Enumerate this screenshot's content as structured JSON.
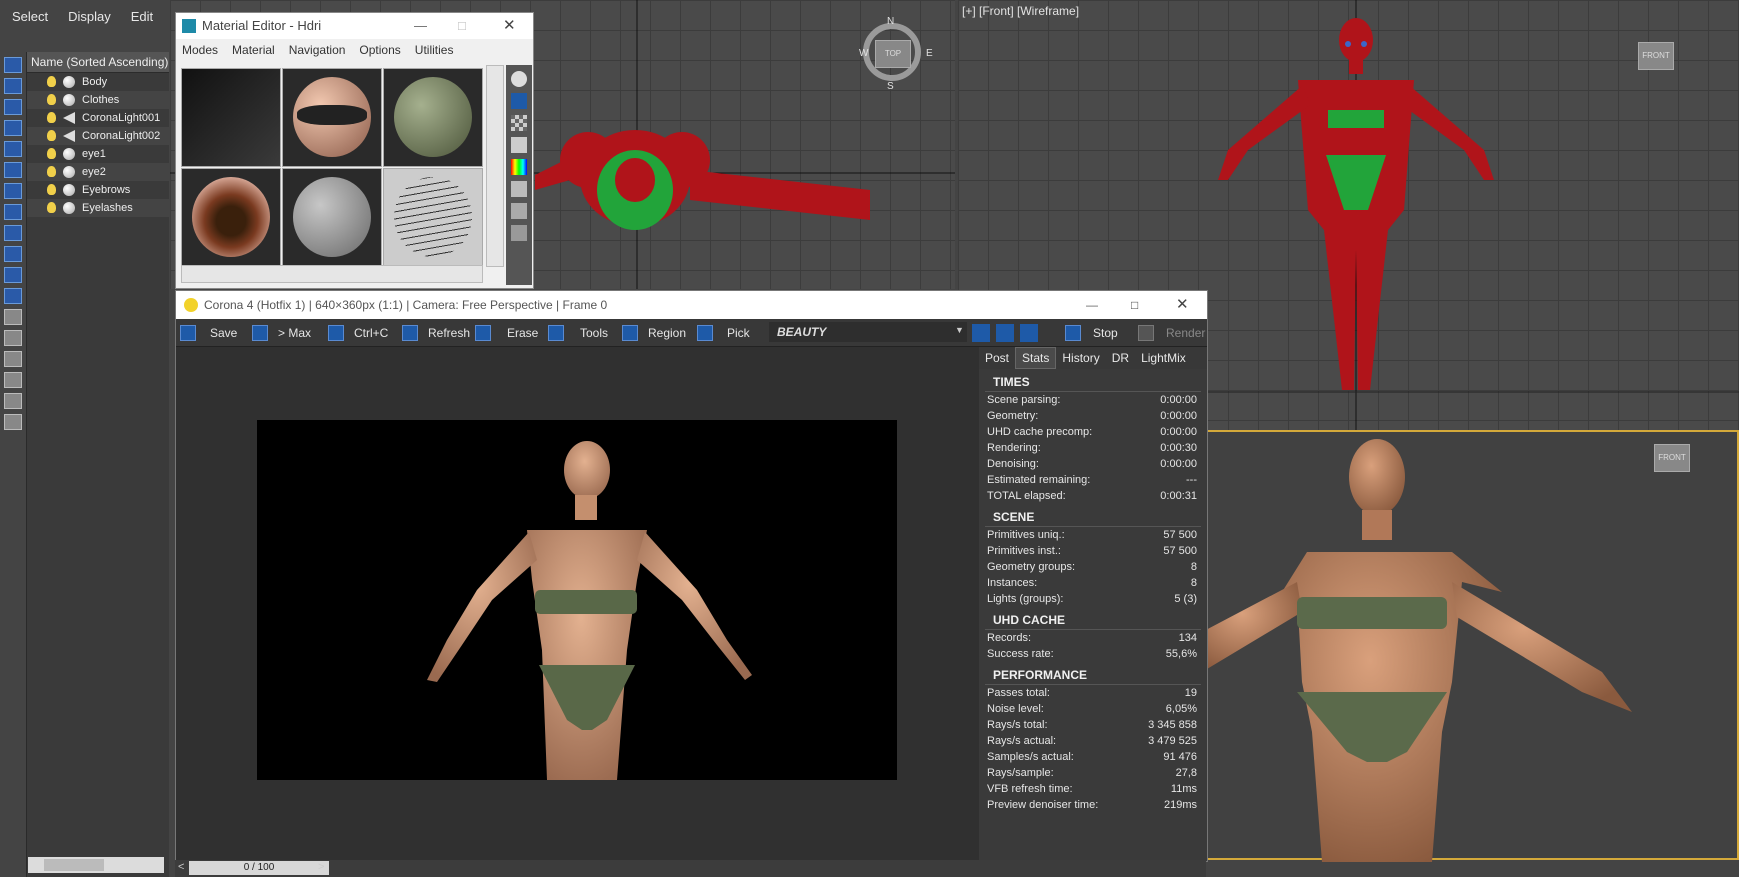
{
  "top_menu": [
    "Select",
    "Display",
    "Edit"
  ],
  "explorer": {
    "header": "Name (Sorted Ascending)",
    "items": [
      {
        "label": "Body",
        "icon": "sphere-icon"
      },
      {
        "label": "Clothes",
        "icon": "sphere-icon"
      },
      {
        "label": "CoronaLight001",
        "icon": "light-icon"
      },
      {
        "label": "CoronaLight002",
        "icon": "light-icon"
      },
      {
        "label": "eye1",
        "icon": "sphere-icon"
      },
      {
        "label": "eye2",
        "icon": "sphere-icon"
      },
      {
        "label": "Eyebrows",
        "icon": "sphere-icon"
      },
      {
        "label": "Eyelashes",
        "icon": "sphere-icon"
      }
    ]
  },
  "viewports": {
    "front_label": "[+] [Front] [Wireframe]",
    "compass": {
      "n": "N",
      "s": "S",
      "e": "E",
      "w": "W",
      "cube": "TOP"
    },
    "front_cube": "FRONT"
  },
  "material_editor": {
    "title": "Material Editor - Hdri",
    "menu": [
      "Modes",
      "Material",
      "Navigation",
      "Options",
      "Utilities"
    ]
  },
  "vfb": {
    "title": "Corona 4 (Hotfix 1) | 640×360px (1:1) | Camera: Free Perspective | Frame 0",
    "toolbar": {
      "save": "Save",
      "to_max": "> Max",
      "copy": "Ctrl+C",
      "refresh": "Refresh",
      "erase": "Erase",
      "tools": "Tools",
      "region": "Region",
      "pick": "Pick",
      "channel": "BEAUTY",
      "stop": "Stop",
      "render": "Render"
    },
    "tabs": [
      "Post",
      "Stats",
      "History",
      "DR",
      "LightMix"
    ],
    "active_tab": "Stats",
    "stats": {
      "times_title": "TIMES",
      "times": [
        {
          "label": "Scene parsing:",
          "value": "0:00:00"
        },
        {
          "label": "Geometry:",
          "value": "0:00:00"
        },
        {
          "label": "UHD cache precomp:",
          "value": "0:00:00"
        },
        {
          "label": "Rendering:",
          "value": "0:00:30"
        },
        {
          "label": "Denoising:",
          "value": "0:00:00"
        },
        {
          "label": "Estimated remaining:",
          "value": "---"
        },
        {
          "label": "TOTAL elapsed:",
          "value": "0:00:31"
        }
      ],
      "scene_title": "SCENE",
      "scene": [
        {
          "label": "Primitives uniq.:",
          "value": "57 500"
        },
        {
          "label": "Primitives inst.:",
          "value": "57 500"
        },
        {
          "label": "Geometry groups:",
          "value": "8"
        },
        {
          "label": "Instances:",
          "value": "8"
        },
        {
          "label": "Lights (groups):",
          "value": "5 (3)"
        }
      ],
      "uhd_title": "UHD CACHE",
      "uhd": [
        {
          "label": "Records:",
          "value": "134"
        },
        {
          "label": "Success rate:",
          "value": "55,6%"
        }
      ],
      "perf_title": "PERFORMANCE",
      "perf": [
        {
          "label": "Passes total:",
          "value": "19"
        },
        {
          "label": "Noise level:",
          "value": "6,05%"
        },
        {
          "label": "Rays/s total:",
          "value": "3 345 858"
        },
        {
          "label": "Rays/s actual:",
          "value": "3 479 525"
        },
        {
          "label": "Samples/s actual:",
          "value": "91 476"
        },
        {
          "label": "Rays/sample:",
          "value": "27,8"
        },
        {
          "label": "VFB refresh time:",
          "value": "11ms"
        },
        {
          "label": "Preview denoiser time:",
          "value": "219ms"
        }
      ]
    }
  },
  "timeline": {
    "frame": "0 / 100"
  },
  "colors": {
    "accent_blue": "#1e5aa8",
    "active_viewport": "#d4a93a",
    "wire_red": "#b0141a",
    "wire_green": "#22a43a"
  }
}
